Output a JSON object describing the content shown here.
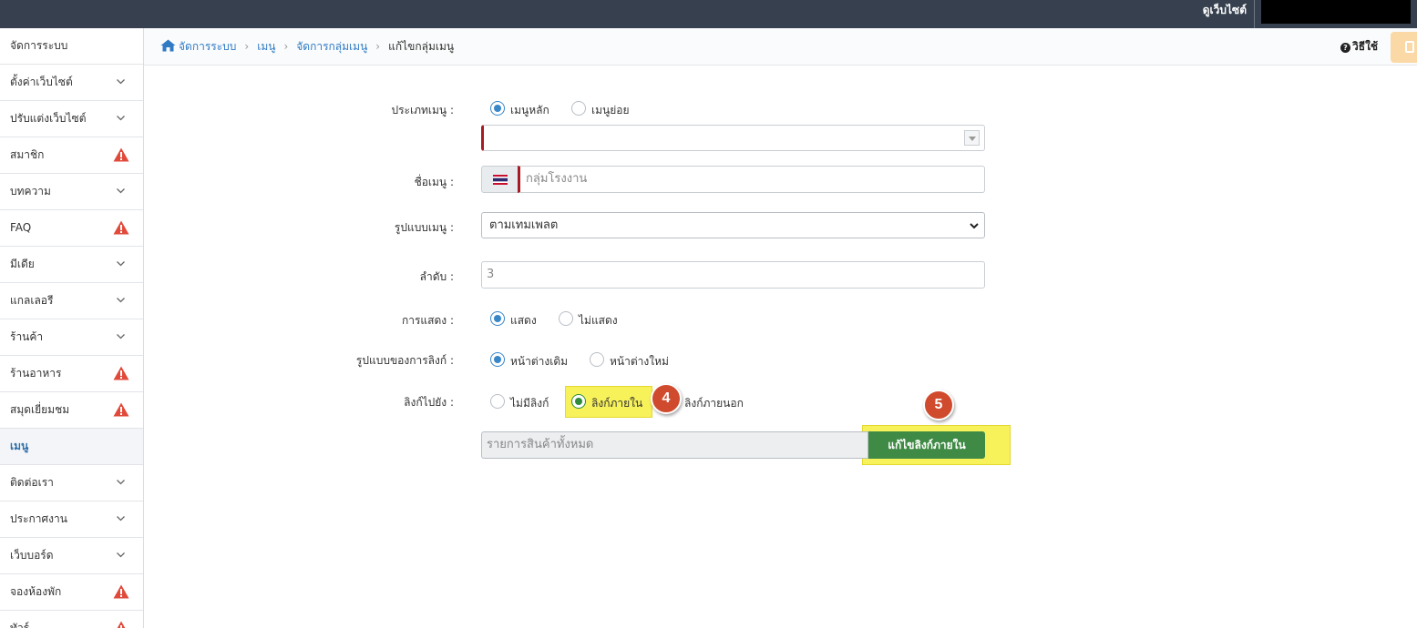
{
  "topbar": {
    "view_site": "ดูเว็บไซต์"
  },
  "sidebar": {
    "items": [
      {
        "label": "จัดการระบบ",
        "icon": "none"
      },
      {
        "label": "ตั้งค่าเว็บไซต์",
        "icon": "chevron"
      },
      {
        "label": "ปรับแต่งเว็บไซต์",
        "icon": "chevron"
      },
      {
        "label": "สมาชิก",
        "icon": "warning"
      },
      {
        "label": "บทความ",
        "icon": "chevron"
      },
      {
        "label": "FAQ",
        "icon": "warning"
      },
      {
        "label": "มีเดีย",
        "icon": "chevron"
      },
      {
        "label": "แกลเลอรี",
        "icon": "chevron"
      },
      {
        "label": "ร้านค้า",
        "icon": "chevron"
      },
      {
        "label": "ร้านอาหาร",
        "icon": "warning"
      },
      {
        "label": "สมุดเยี่ยมชม",
        "icon": "warning"
      },
      {
        "label": "เมนู",
        "icon": "none",
        "active": true
      },
      {
        "label": "ติดต่อเรา",
        "icon": "chevron"
      },
      {
        "label": "ประกาศงาน",
        "icon": "chevron"
      },
      {
        "label": "เว็บบอร์ด",
        "icon": "chevron"
      },
      {
        "label": "จองห้องพัก",
        "icon": "warning"
      },
      {
        "label": "ทัวร์",
        "icon": "warning"
      }
    ],
    "warning_color": "#e04a3a"
  },
  "breadcrumb": {
    "home": "จัดการระบบ",
    "menu": "เมนู",
    "manage": "จัดการกลุ่มเมนู",
    "current": "แก้ไขกลุ่มเมนู"
  },
  "header": {
    "howto": "วิธีใช้"
  },
  "form": {
    "menu_type": {
      "label": "ประเภทเมนู :",
      "opt_main": "เมนูหลัก",
      "opt_sub": "เมนูย่อย",
      "selected": "main"
    },
    "menu_name": {
      "label": "ชื่อเมนู :",
      "placeholder": "กลุ่มโรงงาน"
    },
    "menu_style": {
      "label": "รูปแบบเมนู :",
      "value": "ตามเทมเพลต"
    },
    "order": {
      "label": "ลำดับ :",
      "placeholder": "3"
    },
    "display": {
      "label": "การแสดง :",
      "opt_show": "แสดง",
      "opt_hide": "ไม่แสดง",
      "selected": "show"
    },
    "link_style": {
      "label": "รูปแบบของการลิงก์ :",
      "opt_same": "หน้าต่างเดิม",
      "opt_new": "หน้าต่างใหม่",
      "selected": "same"
    },
    "link_to": {
      "label": "ลิงก์ไปยัง :",
      "opt_none": "ไม่มีลิงก์",
      "opt_internal": "ลิงก์ภายใน",
      "opt_external": "ลิงก์ภายนอก",
      "selected": "internal"
    },
    "internal_link": {
      "placeholder": "รายการสินค้าทั้งหมด",
      "button": "แก้ไขลิงก์ภายใน"
    }
  },
  "annotations": {
    "step4": "4",
    "step5": "5",
    "highlight_color": "#f7f15a",
    "badge_color": "#d04a2e"
  },
  "colors": {
    "topbar": "#36404e",
    "accent": "#2f7bc4",
    "button_green": "#3f8a45",
    "required": "#a51c24"
  }
}
